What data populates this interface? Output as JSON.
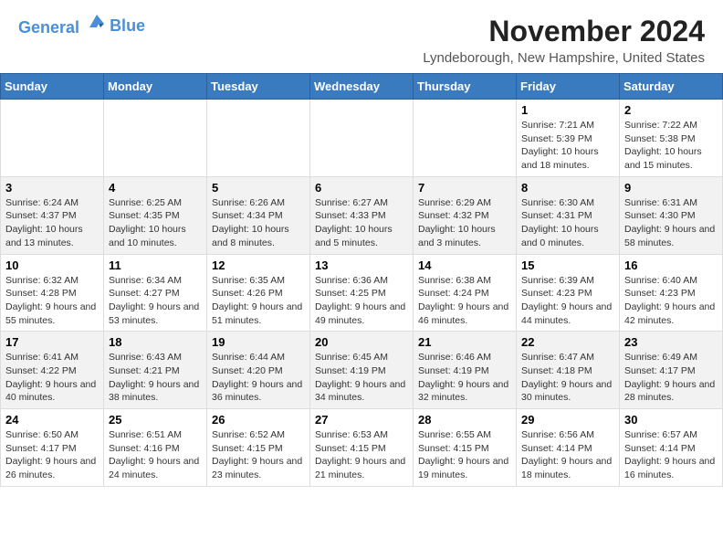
{
  "header": {
    "logo_line1": "General",
    "logo_line2": "Blue",
    "month_title": "November 2024",
    "location": "Lyndeborough, New Hampshire, United States"
  },
  "weekdays": [
    "Sunday",
    "Monday",
    "Tuesday",
    "Wednesday",
    "Thursday",
    "Friday",
    "Saturday"
  ],
  "rows": [
    [
      {
        "day": "",
        "info": ""
      },
      {
        "day": "",
        "info": ""
      },
      {
        "day": "",
        "info": ""
      },
      {
        "day": "",
        "info": ""
      },
      {
        "day": "",
        "info": ""
      },
      {
        "day": "1",
        "info": "Sunrise: 7:21 AM\nSunset: 5:39 PM\nDaylight: 10 hours and 18 minutes."
      },
      {
        "day": "2",
        "info": "Sunrise: 7:22 AM\nSunset: 5:38 PM\nDaylight: 10 hours and 15 minutes."
      }
    ],
    [
      {
        "day": "3",
        "info": "Sunrise: 6:24 AM\nSunset: 4:37 PM\nDaylight: 10 hours and 13 minutes."
      },
      {
        "day": "4",
        "info": "Sunrise: 6:25 AM\nSunset: 4:35 PM\nDaylight: 10 hours and 10 minutes."
      },
      {
        "day": "5",
        "info": "Sunrise: 6:26 AM\nSunset: 4:34 PM\nDaylight: 10 hours and 8 minutes."
      },
      {
        "day": "6",
        "info": "Sunrise: 6:27 AM\nSunset: 4:33 PM\nDaylight: 10 hours and 5 minutes."
      },
      {
        "day": "7",
        "info": "Sunrise: 6:29 AM\nSunset: 4:32 PM\nDaylight: 10 hours and 3 minutes."
      },
      {
        "day": "8",
        "info": "Sunrise: 6:30 AM\nSunset: 4:31 PM\nDaylight: 10 hours and 0 minutes."
      },
      {
        "day": "9",
        "info": "Sunrise: 6:31 AM\nSunset: 4:30 PM\nDaylight: 9 hours and 58 minutes."
      }
    ],
    [
      {
        "day": "10",
        "info": "Sunrise: 6:32 AM\nSunset: 4:28 PM\nDaylight: 9 hours and 55 minutes."
      },
      {
        "day": "11",
        "info": "Sunrise: 6:34 AM\nSunset: 4:27 PM\nDaylight: 9 hours and 53 minutes."
      },
      {
        "day": "12",
        "info": "Sunrise: 6:35 AM\nSunset: 4:26 PM\nDaylight: 9 hours and 51 minutes."
      },
      {
        "day": "13",
        "info": "Sunrise: 6:36 AM\nSunset: 4:25 PM\nDaylight: 9 hours and 49 minutes."
      },
      {
        "day": "14",
        "info": "Sunrise: 6:38 AM\nSunset: 4:24 PM\nDaylight: 9 hours and 46 minutes."
      },
      {
        "day": "15",
        "info": "Sunrise: 6:39 AM\nSunset: 4:23 PM\nDaylight: 9 hours and 44 minutes."
      },
      {
        "day": "16",
        "info": "Sunrise: 6:40 AM\nSunset: 4:23 PM\nDaylight: 9 hours and 42 minutes."
      }
    ],
    [
      {
        "day": "17",
        "info": "Sunrise: 6:41 AM\nSunset: 4:22 PM\nDaylight: 9 hours and 40 minutes."
      },
      {
        "day": "18",
        "info": "Sunrise: 6:43 AM\nSunset: 4:21 PM\nDaylight: 9 hours and 38 minutes."
      },
      {
        "day": "19",
        "info": "Sunrise: 6:44 AM\nSunset: 4:20 PM\nDaylight: 9 hours and 36 minutes."
      },
      {
        "day": "20",
        "info": "Sunrise: 6:45 AM\nSunset: 4:19 PM\nDaylight: 9 hours and 34 minutes."
      },
      {
        "day": "21",
        "info": "Sunrise: 6:46 AM\nSunset: 4:19 PM\nDaylight: 9 hours and 32 minutes."
      },
      {
        "day": "22",
        "info": "Sunrise: 6:47 AM\nSunset: 4:18 PM\nDaylight: 9 hours and 30 minutes."
      },
      {
        "day": "23",
        "info": "Sunrise: 6:49 AM\nSunset: 4:17 PM\nDaylight: 9 hours and 28 minutes."
      }
    ],
    [
      {
        "day": "24",
        "info": "Sunrise: 6:50 AM\nSunset: 4:17 PM\nDaylight: 9 hours and 26 minutes."
      },
      {
        "day": "25",
        "info": "Sunrise: 6:51 AM\nSunset: 4:16 PM\nDaylight: 9 hours and 24 minutes."
      },
      {
        "day": "26",
        "info": "Sunrise: 6:52 AM\nSunset: 4:15 PM\nDaylight: 9 hours and 23 minutes."
      },
      {
        "day": "27",
        "info": "Sunrise: 6:53 AM\nSunset: 4:15 PM\nDaylight: 9 hours and 21 minutes."
      },
      {
        "day": "28",
        "info": "Sunrise: 6:55 AM\nSunset: 4:15 PM\nDaylight: 9 hours and 19 minutes."
      },
      {
        "day": "29",
        "info": "Sunrise: 6:56 AM\nSunset: 4:14 PM\nDaylight: 9 hours and 18 minutes."
      },
      {
        "day": "30",
        "info": "Sunrise: 6:57 AM\nSunset: 4:14 PM\nDaylight: 9 hours and 16 minutes."
      }
    ]
  ],
  "row_classes": [
    "row1",
    "row2",
    "row3",
    "row4",
    "row5"
  ]
}
